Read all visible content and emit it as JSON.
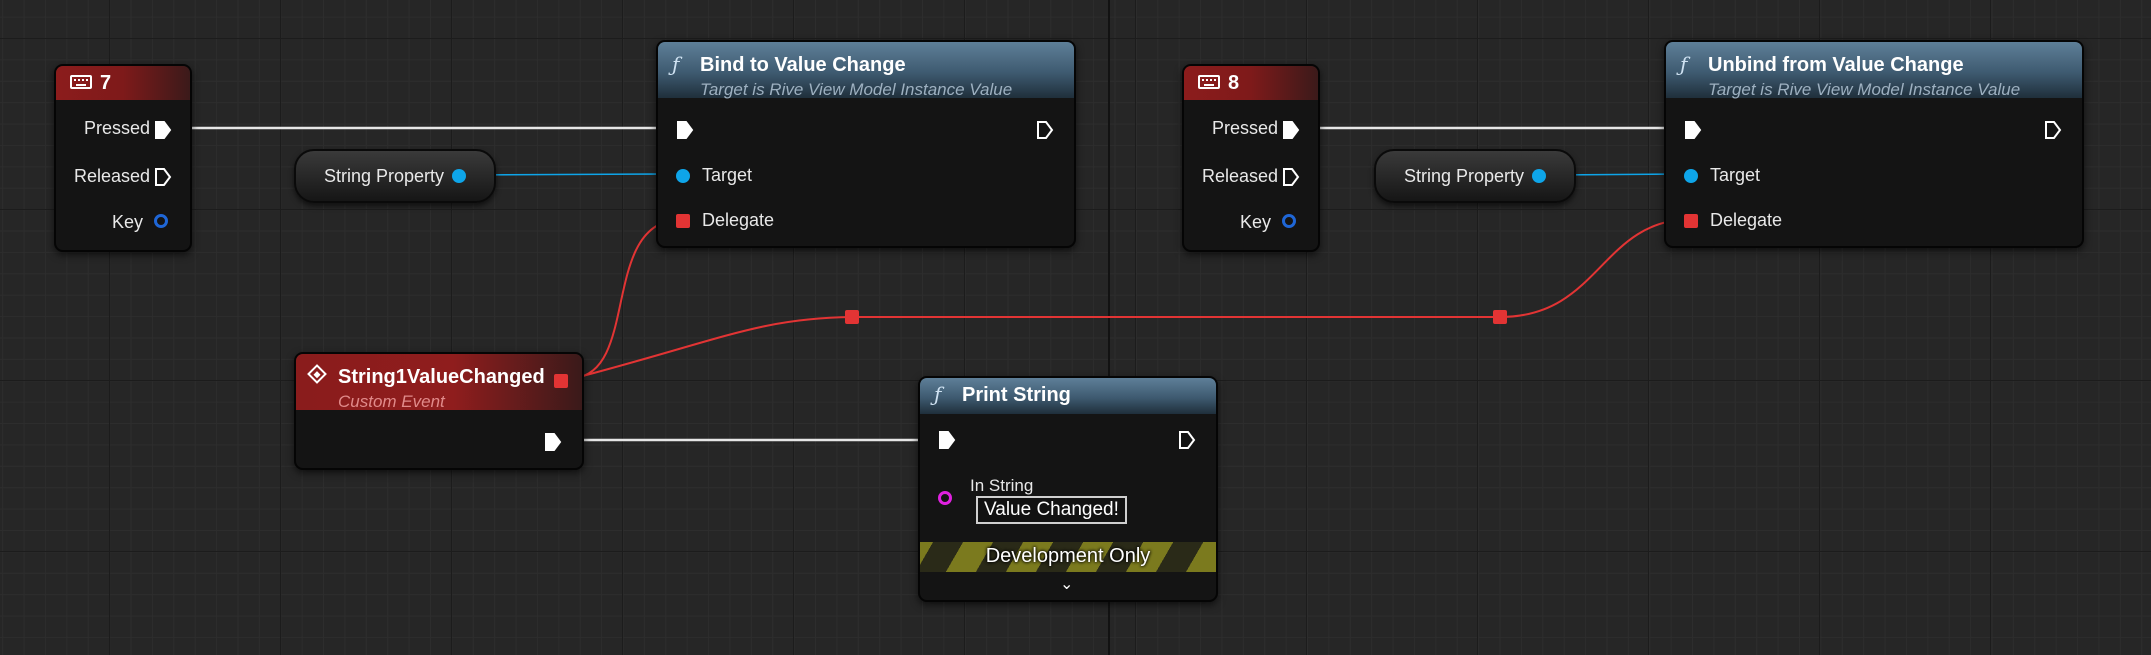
{
  "graph": {
    "key_event_7": {
      "title": "7",
      "pins": {
        "pressed": "Pressed",
        "released": "Released",
        "key": "Key"
      }
    },
    "key_event_8": {
      "title": "8",
      "pins": {
        "pressed": "Pressed",
        "released": "Released",
        "key": "Key"
      }
    },
    "variable_left": {
      "label": "String Property"
    },
    "variable_right": {
      "label": "String Property"
    },
    "bind_node": {
      "title": "Bind to Value Change",
      "subtitle": "Target is Rive View Model Instance Value",
      "pins": {
        "target": "Target",
        "delegate": "Delegate"
      }
    },
    "unbind_node": {
      "title": "Unbind from Value Change",
      "subtitle": "Target is Rive View Model Instance Value",
      "pins": {
        "target": "Target",
        "delegate": "Delegate"
      }
    },
    "custom_event": {
      "title": "String1ValueChanged",
      "subtitle": "Custom Event"
    },
    "print_string": {
      "title": "Print String",
      "in_string_label": "In String",
      "in_string_value": "Value Changed!",
      "dev_only": "Development Only"
    }
  },
  "colors": {
    "exec_wire": "#e6e6e6",
    "object_pin": "#0ea5e9",
    "delegate_pin": "#e23434",
    "string_pin": "#e021e0",
    "key_pin": "#1f66d6",
    "function_header": "#4f6f88",
    "event_header": "#8a1c1c"
  },
  "icons": {
    "function": "function-icon",
    "keyboard": "keyboard-icon",
    "event": "event-diamond-icon",
    "expand": "chevron-down-icon"
  }
}
